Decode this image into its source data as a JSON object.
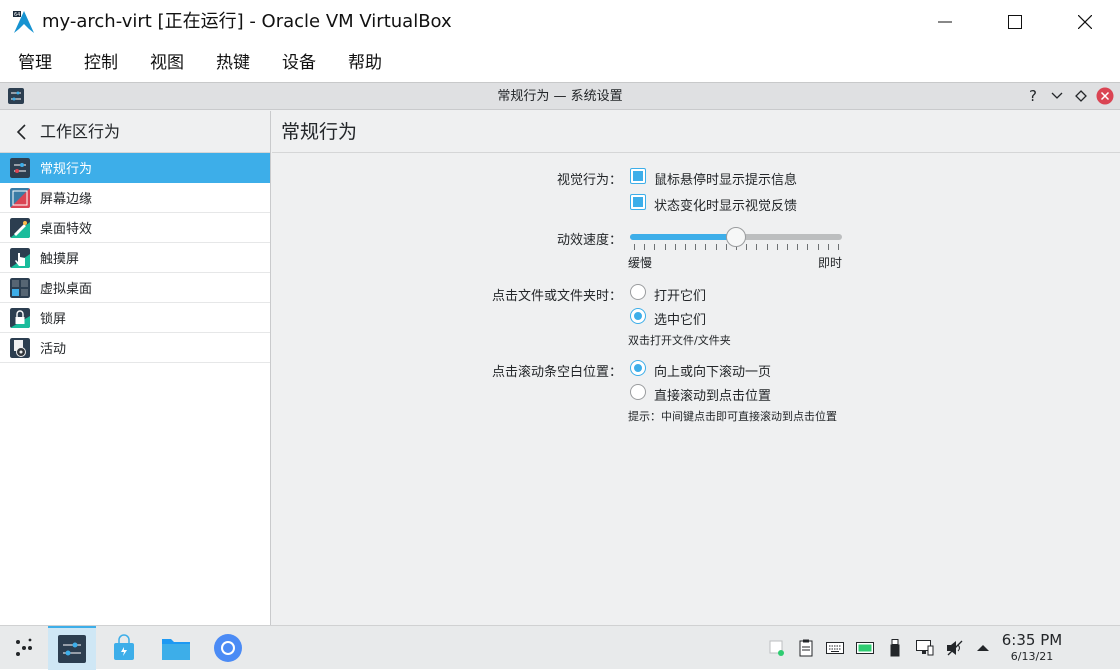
{
  "window": {
    "title": "my-arch-virt [正在运行] - Oracle VM VirtualBox",
    "menu": [
      "管理",
      "控制",
      "视图",
      "热键",
      "设备",
      "帮助"
    ]
  },
  "settings_window": {
    "title": "常规行为 — 系统设置"
  },
  "sidebar": {
    "header": "工作区行为",
    "items": [
      {
        "label": "常规行为",
        "icon": "general-behavior-icon",
        "selected": true
      },
      {
        "label": "屏幕边缘",
        "icon": "screen-edges-icon",
        "selected": false
      },
      {
        "label": "桌面特效",
        "icon": "desktop-effects-icon",
        "selected": false
      },
      {
        "label": "触摸屏",
        "icon": "touch-screen-icon",
        "selected": false
      },
      {
        "label": "虚拟桌面",
        "icon": "virtual-desktops-icon",
        "selected": false
      },
      {
        "label": "锁屏",
        "icon": "lock-screen-icon",
        "selected": false
      },
      {
        "label": "活动",
        "icon": "activities-icon",
        "selected": false
      }
    ]
  },
  "main": {
    "title": "常规行为",
    "visual_behavior": {
      "label": "视觉行为：",
      "options": [
        {
          "label": "鼠标悬停时显示提示信息",
          "checked": true
        },
        {
          "label": "状态变化时显示视觉反馈",
          "checked": true
        }
      ]
    },
    "animation_speed": {
      "label": "动效速度：",
      "min_label": "缓慢",
      "max_label": "即时",
      "value": 0.5
    },
    "click_files": {
      "label": "点击文件或文件夹时：",
      "options": [
        {
          "label": "打开它们",
          "selected": false
        },
        {
          "label": "选中它们",
          "selected": true
        }
      ],
      "hint": "双击打开文件/文件夹"
    },
    "click_scrollbar": {
      "label": "点击滚动条空白位置：",
      "options": [
        {
          "label": "向上或向下滚动一页",
          "selected": true
        },
        {
          "label": "直接滚动到点击位置",
          "selected": false
        }
      ],
      "hint": "提示：中间键点击即可直接滚动到点击位置"
    }
  },
  "taskbar": {
    "time": "6:35 PM",
    "date": "6/13/21"
  },
  "colors": {
    "accent": "#3daee9",
    "selected_text": "#ffffff",
    "guest_background": "#eff0f1"
  }
}
